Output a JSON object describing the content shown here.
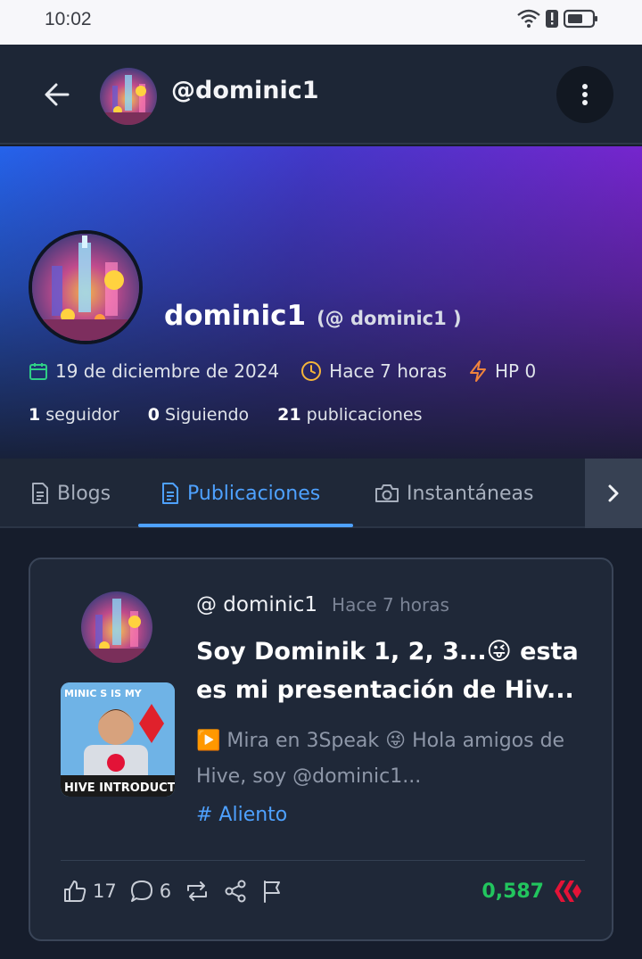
{
  "status_bar": {
    "time": "10:02"
  },
  "app_bar": {
    "title": "@dominic1"
  },
  "profile": {
    "name": "dominic1",
    "handle": "(@ dominic1 )",
    "joined": "19 de diciembre de 2024",
    "last_active": "Hace 7 horas",
    "hp": "HP 0",
    "followers": {
      "count": "1",
      "label": "seguidor"
    },
    "following": {
      "count": "0",
      "label": "Siguiendo"
    },
    "posts": {
      "count": "21",
      "label": "publicaciones"
    }
  },
  "tabs": [
    {
      "label": "Blogs",
      "icon": "document-icon",
      "active": false
    },
    {
      "label": "Publicaciones",
      "icon": "document-icon",
      "active": true
    },
    {
      "label": "Instantáneas",
      "icon": "camera-icon",
      "active": false
    }
  ],
  "post": {
    "author": "@ dominic1",
    "time": "Hace 7 horas",
    "title": "Soy Dominik 1, 2, 3...😜 esta es mi presentación de Hiv...",
    "excerpt": "▶️ Mira en 3Speak 😜 Hola amigos de Hive, soy @dominic1...",
    "tag": "# Aliento",
    "thumbnail_text": {
      "top": "MINIC S IS MY",
      "bottom": "HIVE INTRODUCTION"
    },
    "likes": "17",
    "comments": "6",
    "payout": "0,587"
  },
  "colors": {
    "accent": "#4ea1ff",
    "payout": "#22c55e",
    "hive": "#e31337"
  }
}
